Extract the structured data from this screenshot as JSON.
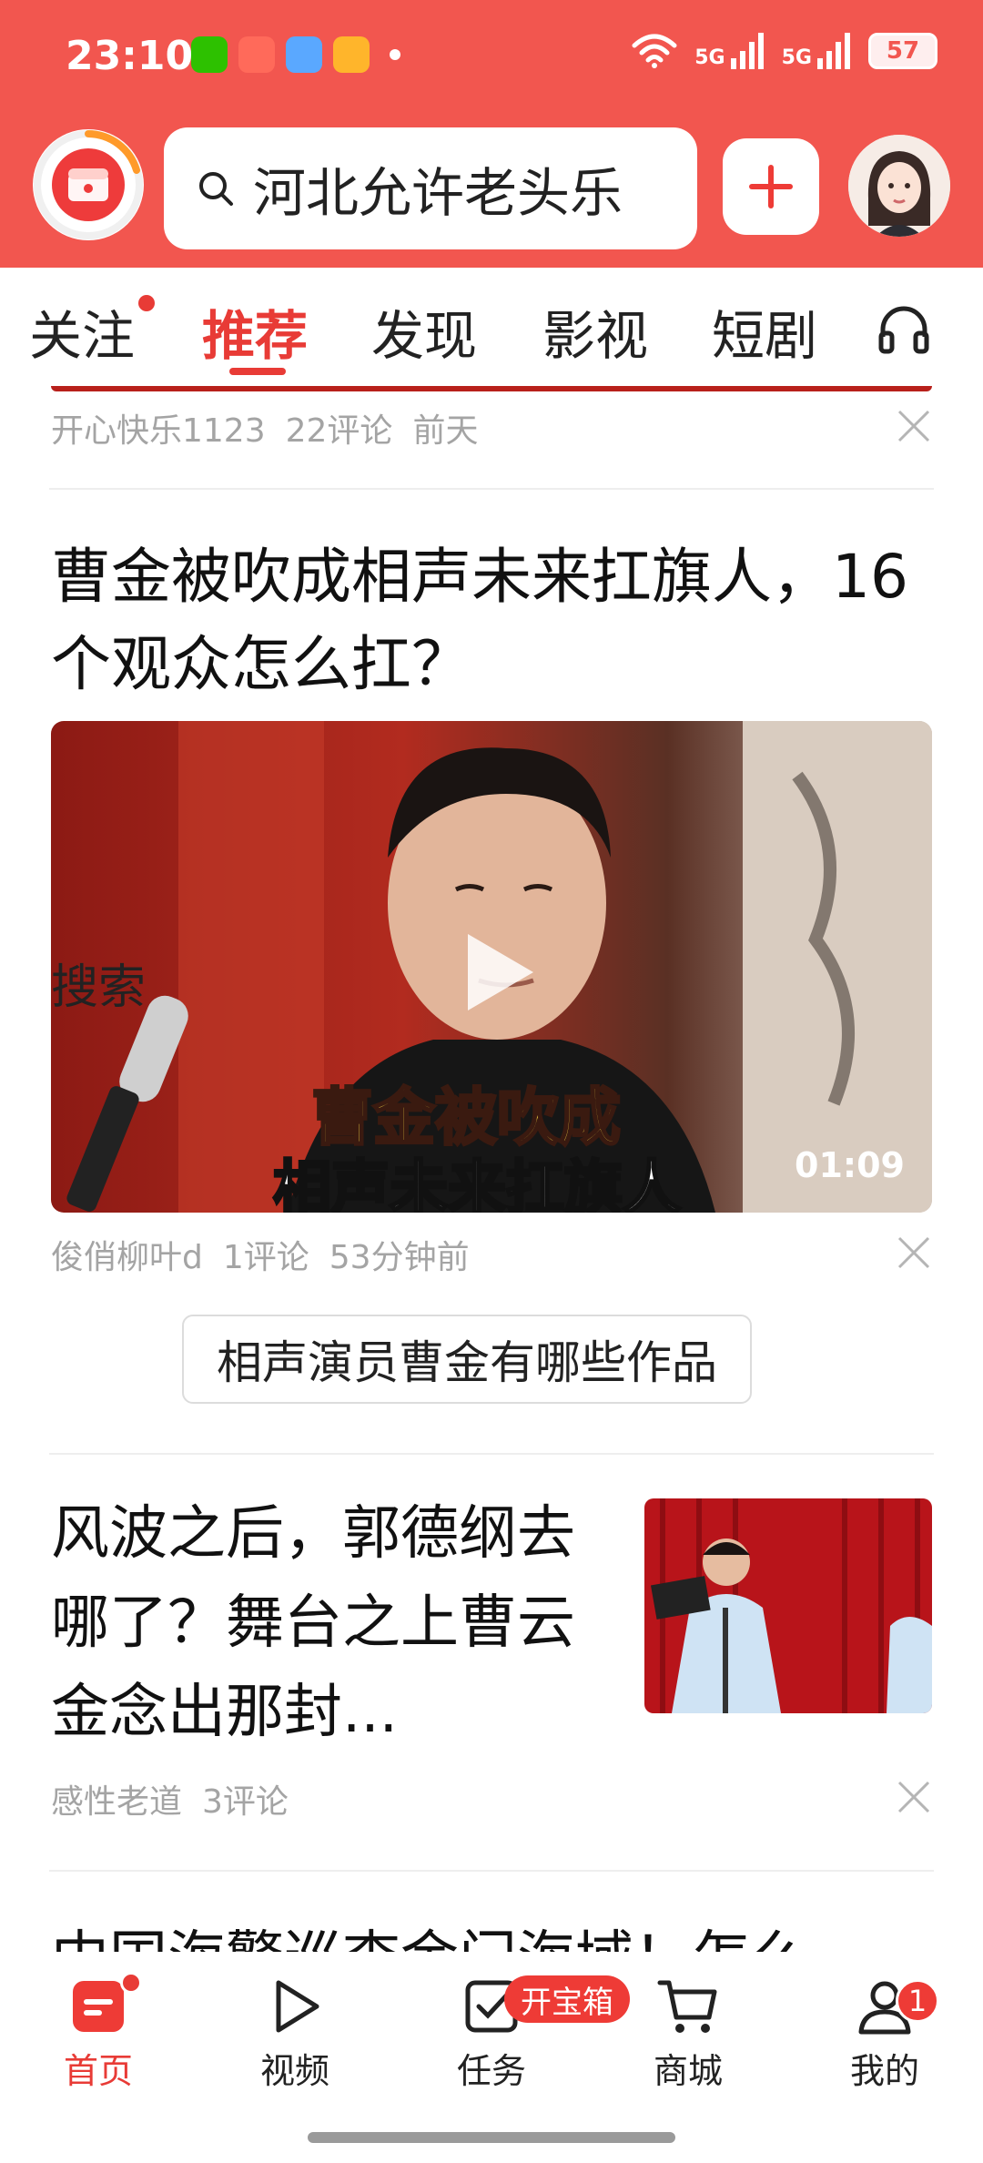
{
  "status_bar": {
    "time": "23:10",
    "signal_1": "5G",
    "signal_2": "5G",
    "battery": "57"
  },
  "header": {
    "search_query": "河北允许老头乐",
    "icons": [
      "app-logo-icon",
      "search-icon",
      "plus-icon",
      "avatar"
    ]
  },
  "tabs": [
    {
      "label": "关注",
      "has_dot": true
    },
    {
      "label": "推荐",
      "active": true
    },
    {
      "label": "发现"
    },
    {
      "label": "影视"
    },
    {
      "label": "短剧"
    }
  ],
  "feed": {
    "prev_item_meta": {
      "author": "开心快乐1123",
      "comments": "22评论",
      "time": "前天"
    },
    "video_item": {
      "title": "曹金被吹成相声未来扛旗人，16个观众怎么扛？",
      "caption_line1": "曹金被吹成",
      "caption_line2": "相声未来扛旗人",
      "duration": "01:09",
      "author": "俊俏柳叶d",
      "comments": "1评论",
      "time": "53分钟前"
    },
    "search_suggestion": {
      "label": "搜索",
      "query": "相声演员曹金有哪些作品"
    },
    "article_item": {
      "title": "风波之后，郭德纲去哪了？舞台之上曹云金念出那封...",
      "author": "感性老道",
      "comments": "3评论"
    },
    "next_item_title": "中国海警巡查金门海域！怎么"
  },
  "bottom_nav": [
    {
      "label": "首页",
      "icon": "home-icon",
      "active": true
    },
    {
      "label": "视频",
      "icon": "play-icon"
    },
    {
      "label": "任务",
      "icon": "task-check-icon",
      "badge": "开宝箱"
    },
    {
      "label": "商城",
      "icon": "cart-icon"
    },
    {
      "label": "我的",
      "icon": "person-icon",
      "badge": "1"
    }
  ],
  "colors": {
    "brand_red": "#f2564f",
    "accent_red": "#e83b36",
    "meta_gray": "#a4a4a4"
  }
}
